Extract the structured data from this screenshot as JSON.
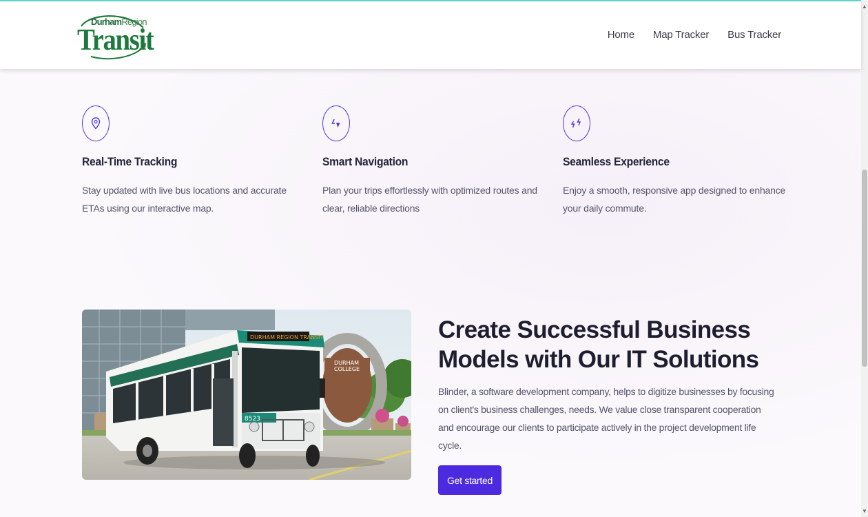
{
  "brand": {
    "region_bold": "Durham",
    "region_light": "Region",
    "name": "Transit"
  },
  "nav": {
    "items": [
      {
        "label": "Home"
      },
      {
        "label": "Map Tracker"
      },
      {
        "label": "Bus Tracker"
      }
    ]
  },
  "features": [
    {
      "icon": "location-pin-icon",
      "title": "Real-Time Tracking",
      "description": "Stay updated with live bus locations and accurate ETAs using our interactive map."
    },
    {
      "icon": "navigation-icon",
      "title": "Smart Navigation",
      "description": "Plan your trips effortlessly with optimized routes and clear, reliable directions"
    },
    {
      "icon": "lightning-icon",
      "title": "Seamless Experience",
      "description": "Enjoy a smooth, responsive app designed to enhance your daily commute."
    }
  ],
  "cta": {
    "heading": "Create Successful Business Models with Our IT Solutions",
    "body": "Blinder, a software development company, helps to digitize businesses by focusing on client's business challenges, needs. We value close transparent cooperation and encourage our clients to participate actively in the project development life cycle.",
    "button_label": "Get started"
  },
  "photo": {
    "bus_number": "8523",
    "destination_sign": "DURHAM REGION TRANSIT",
    "building_sign_line1": "DURHAM",
    "building_sign_line2": "COLLEGE"
  },
  "colors": {
    "accent": "#4b2ae0",
    "brand_green": "#1d7a3c",
    "top_border": "#5fd6cf"
  }
}
